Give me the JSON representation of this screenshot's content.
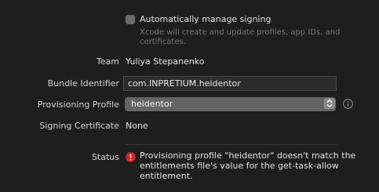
{
  "signing": {
    "auto_label": "Automatically manage signing",
    "auto_checked": false,
    "help_text": "Xcode will create and update profiles, app IDs, and certificates."
  },
  "team": {
    "label": "Team",
    "value": "Yuliya Stepanenko"
  },
  "bundle": {
    "label": "Bundle Identifier",
    "value": "com.INPRETIUM.heidentor"
  },
  "profile": {
    "label": "Provisioning Profile",
    "selected": "heidentor",
    "info_icon": "info-icon"
  },
  "certificate": {
    "label": "Signing Certificate",
    "value": "None"
  },
  "status": {
    "label": "Status",
    "icon": "error-icon",
    "icon_color": "#e0222a",
    "message": "Provisioning profile \"heidentor\" doesn't match the entitlements file's value for the get-task-allow entitlement."
  }
}
